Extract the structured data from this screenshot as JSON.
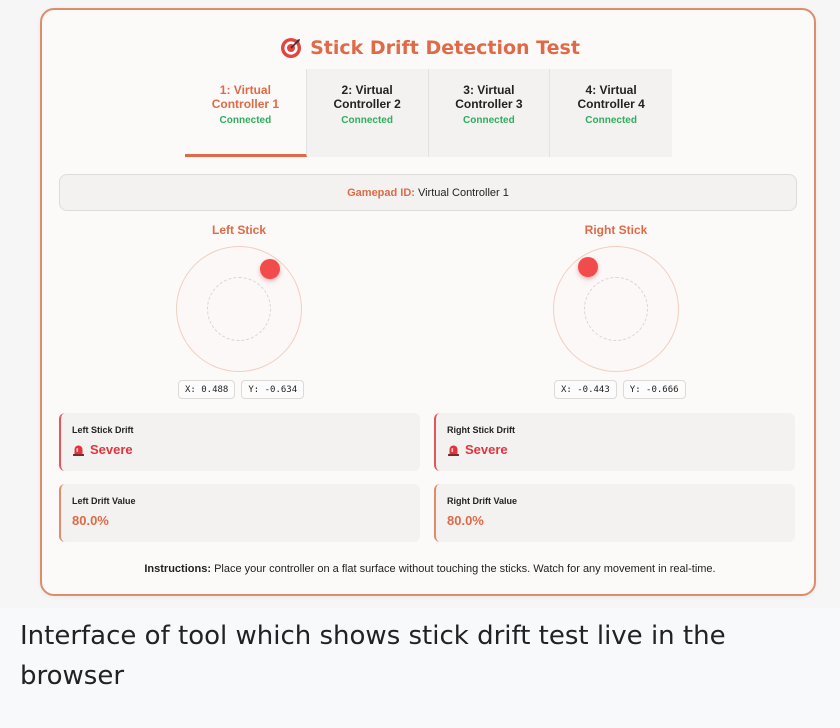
{
  "app": {
    "title": "Stick Drift Detection Test",
    "title_icon": "target-icon",
    "accent_color": "#df6a47",
    "connected_color": "#2fae5c",
    "severe_color": "#e0353d"
  },
  "tabs": [
    {
      "name": "1: Virtual Controller 1",
      "status": "Connected",
      "active": true
    },
    {
      "name": "2: Virtual Controller 2",
      "status": "Connected",
      "active": false
    },
    {
      "name": "3: Virtual Controller 3",
      "status": "Connected",
      "active": false
    },
    {
      "name": "4: Virtual Controller 4",
      "status": "Connected",
      "active": false
    }
  ],
  "gamepad": {
    "label": "Gamepad ID:",
    "value": "Virtual Controller 1"
  },
  "left_stick": {
    "title": "Left Stick",
    "x": "X: 0.488",
    "y": "Y: -0.634",
    "x_value": 0.488,
    "y_value": -0.634
  },
  "right_stick": {
    "title": "Right Stick",
    "x": "X: -0.443",
    "y": "Y: -0.666",
    "x_value": -0.443,
    "y_value": -0.666
  },
  "drift": {
    "left_label": "Left Stick Drift",
    "left_status": "Severe",
    "right_label": "Right Stick Drift",
    "right_status": "Severe",
    "status_icon": "alarm-light-icon"
  },
  "drift_value": {
    "left_label": "Left Drift Value",
    "left_value": "80.0%",
    "right_label": "Right Drift Value",
    "right_value": "80.0%"
  },
  "instructions": {
    "label": "Instructions:",
    "text": "Place your controller on a flat surface without touching the sticks. Watch for any movement in real-time."
  },
  "caption": "Interface of tool which shows stick drift test live in the browser"
}
